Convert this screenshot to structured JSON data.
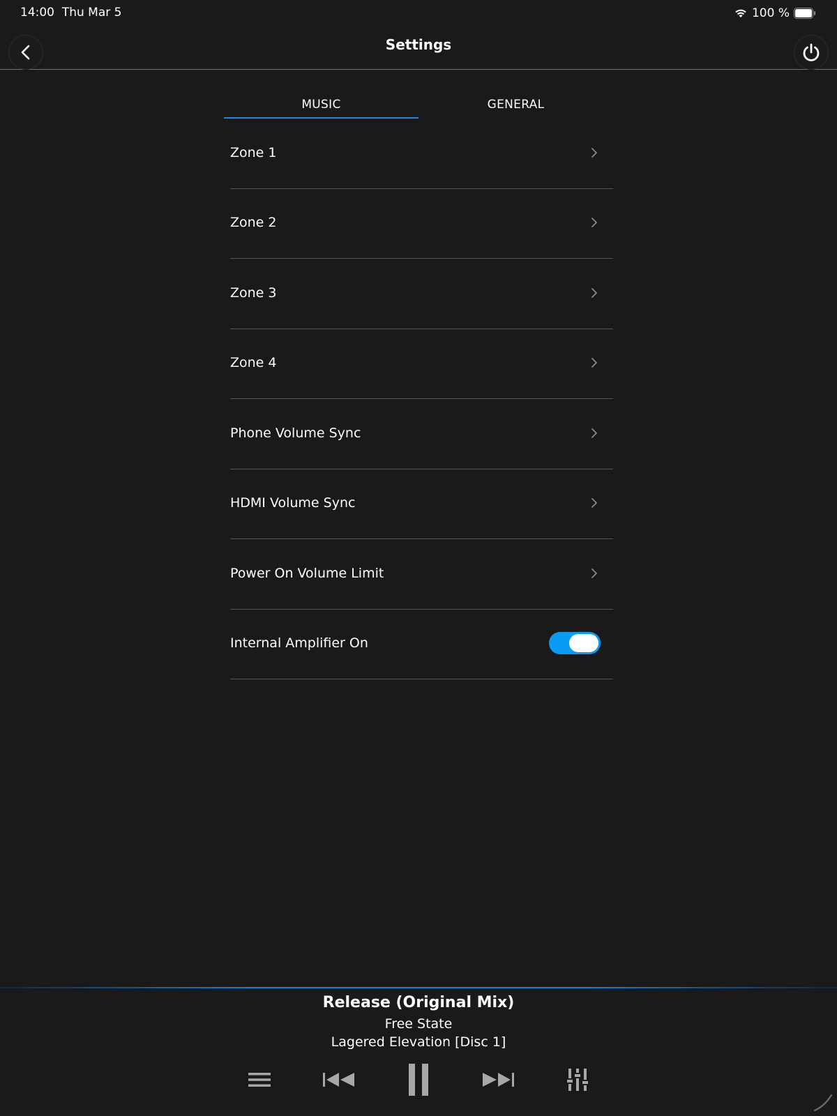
{
  "status": {
    "time": "14:00",
    "date": "Thu Mar 5",
    "battery": "100 %"
  },
  "header": {
    "title": "Settings"
  },
  "tabs": [
    {
      "label": "MUSIC",
      "active": true
    },
    {
      "label": "GENERAL",
      "active": false
    }
  ],
  "settings": [
    {
      "label": "Zone 1",
      "control": "chevron"
    },
    {
      "label": "Zone 2",
      "control": "chevron"
    },
    {
      "label": "Zone 3",
      "control": "chevron"
    },
    {
      "label": "Zone 4",
      "control": "chevron"
    },
    {
      "label": "Phone Volume Sync",
      "control": "chevron"
    },
    {
      "label": "HDMI Volume Sync",
      "control": "chevron"
    },
    {
      "label": "Power On Volume Limit",
      "control": "chevron"
    },
    {
      "label": "Internal Amplifier On",
      "control": "toggle",
      "on": true
    }
  ],
  "player": {
    "title": "Release (Original Mix)",
    "artist": "Free State",
    "album": "Lagered Elevation [Disc 1]",
    "controls": [
      "queue-icon",
      "previous-icon",
      "pause-icon",
      "next-icon",
      "equalizer-icon"
    ]
  },
  "colors": {
    "background": "#1a1a1b",
    "accent": "#1e88e5",
    "toggle_on": "#0a9cf5"
  }
}
